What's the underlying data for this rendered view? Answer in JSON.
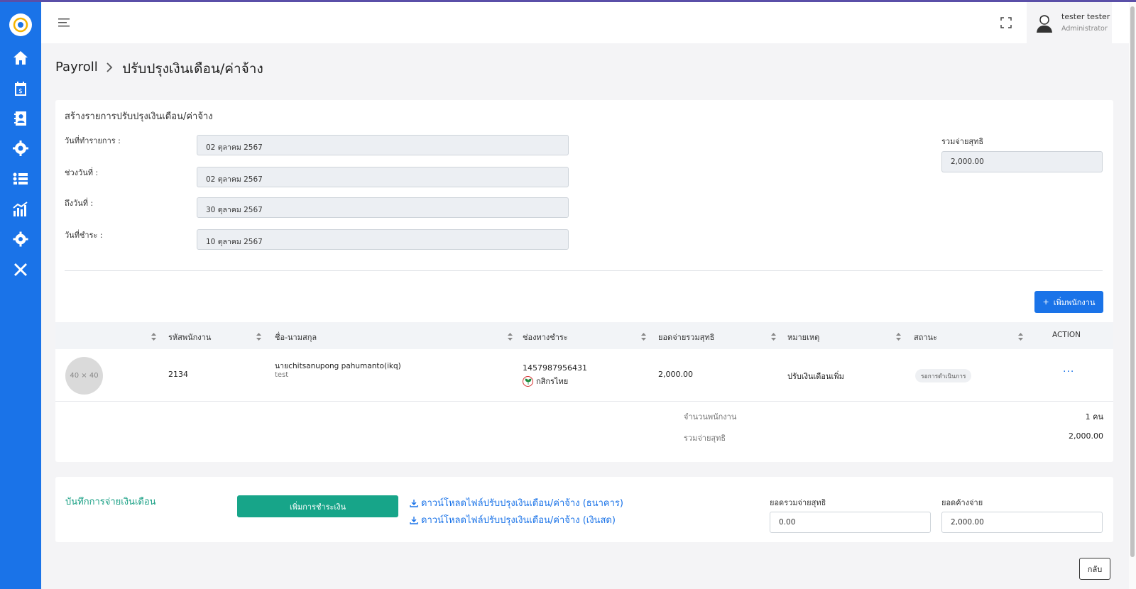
{
  "app": {
    "colors": {
      "primary": "#1a73e8",
      "success": "#17a589",
      "sidebar": "#1a73e8"
    }
  },
  "sidebar": {
    "items": [
      {
        "icon": "home-icon"
      },
      {
        "icon": "payroll-calendar-icon"
      },
      {
        "icon": "contacts-icon"
      },
      {
        "icon": "team-settings-icon"
      },
      {
        "icon": "list-icon"
      },
      {
        "icon": "analytics-icon"
      },
      {
        "icon": "gear-icon"
      },
      {
        "icon": "tools-icon"
      }
    ]
  },
  "header": {
    "user_name": "tester tester",
    "user_role": "Administrator"
  },
  "breadcrumb": {
    "root": "Payroll",
    "current": "ปรับปรุงเงินเดือน/ค่าจ้าง"
  },
  "form": {
    "title": "สร้างรายการปรับปรุงเงินเดือน/ค่าจ้าง",
    "transaction_date_label": "วันที่ทำรายการ :",
    "transaction_date": "02 ตุลาคม 2567",
    "period_start_label": "ช่วงวันที่ :",
    "period_start": "02 ตุลาคม 2567",
    "period_end_label": "ถึงวันที่ :",
    "period_end": "30 ตุลาคม 2567",
    "payment_date_label": "วันที่ชำระ :",
    "payment_date": "10 ตุลาคม 2567",
    "net_total_label": "รวมจ่ายสุทธิ",
    "net_total": "2,000.00",
    "add_employee_label": "เพิ่มพนักงาน"
  },
  "table": {
    "headers": {
      "employee_id": "รหัสพนักงาน",
      "name": "ชื่อ-นามสกุล",
      "channel": "ช่องทางชำระ",
      "net_amount": "ยอดจ่ายรวมสุทธิ",
      "remark": "หมายเหตุ",
      "status": "สถานะ",
      "action": "ACTION"
    },
    "rows": [
      {
        "avatar_placeholder": "40 × 40",
        "employee_id": "2134",
        "name": "นายchitsanupong pahumanto(ikq)",
        "note": "test",
        "account_no": "1457987956431",
        "bank": "กสิกรไทย",
        "net_amount": "2,000.00",
        "remark": "ปรับเงินเดือนเพิ่ม",
        "status": "รอการดำเนินการ",
        "action": "···"
      }
    ],
    "summary": {
      "employee_count_label": "จำนวนพนักงาน",
      "employee_count": "1 คน",
      "net_total_label": "รวมจ่ายสุทธิ",
      "net_total": "2,000.00"
    }
  },
  "payment": {
    "title": "บันทึกการจ่ายเงินเดือน",
    "add_payment_label": "เพิ่มการชำระเงิน",
    "download_bank": "ดาวน์โหลดไฟล์ปรับปรุงเงินเดือน/ค่าจ้าง (ธนาคาร)",
    "download_cash": "ดาวน์โหลดไฟล์ปรับปรุงเงินเดือน/ค่าจ้าง (เงินสด)",
    "paid_total_label": "ยอดรวมจ่ายสุทธิ",
    "paid_total": "0.00",
    "outstanding_label": "ยอดค้างจ่าย",
    "outstanding": "2,000.00"
  },
  "footer": {
    "back_label": "กลับ"
  }
}
